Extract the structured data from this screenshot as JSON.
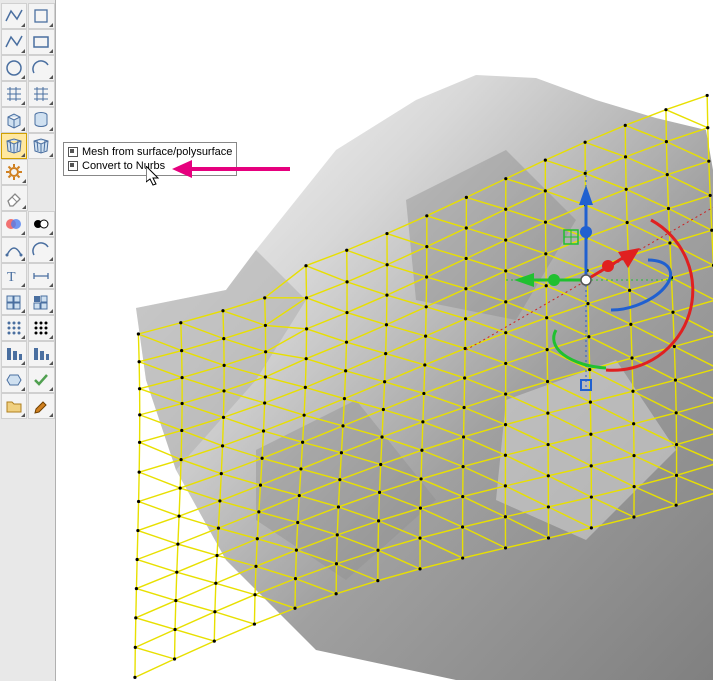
{
  "toolbar": {
    "rows": [
      {
        "a": {
          "name": "chain-edges-icon",
          "color": "#4a6fa0"
        },
        "b": {
          "name": "align-icon",
          "color": "#4a6fa0"
        }
      },
      {
        "a": {
          "name": "polyline-icon",
          "color": "#4a6fa0"
        },
        "b": {
          "name": "rectangle-icon",
          "color": "#4a6fa0"
        }
      },
      {
        "a": {
          "name": "circle-icon",
          "color": "#4a6fa0"
        },
        "b": {
          "name": "arc-icon",
          "color": "#4a6fa0"
        }
      },
      {
        "a": {
          "name": "grid-snap-icon",
          "color": "#4a6fa0"
        },
        "b": {
          "name": "plane-icon",
          "color": "#4a6fa0"
        }
      },
      {
        "a": {
          "name": "solid-box-icon",
          "color": "#4a6fa0"
        },
        "b": {
          "name": "solid-cylinder-icon",
          "color": "#4a6fa0"
        }
      },
      {
        "a": {
          "name": "mesh-icon",
          "color": "#4a6fa0",
          "active": true
        },
        "b": {
          "name": "mesh-convert-icon",
          "color": "#4a6fa0"
        }
      },
      {
        "a": {
          "name": "gears-icon",
          "color": "#d08020"
        },
        "b": null
      },
      {
        "a": {
          "name": "eraser-icon",
          "color": "#808080"
        },
        "b": null
      },
      {
        "a": {
          "name": "layers-icon",
          "color": "#4a6fa0"
        },
        "b": {
          "name": "color-swatch-icon",
          "color": "#000"
        }
      },
      {
        "a": {
          "name": "curve-from-two-views-icon",
          "color": "#4a6fa0"
        },
        "b": {
          "name": "tween-curves-icon",
          "color": "#4a6fa0"
        }
      },
      {
        "a": {
          "name": "text-icon",
          "color": "#4a6fa0"
        },
        "b": {
          "name": "dimension-icon",
          "color": "#4a6fa0"
        }
      },
      {
        "a": {
          "name": "block-manager-icon",
          "color": "#4a6fa0"
        },
        "b": {
          "name": "block-edit-icon",
          "color": "#4a6fa0"
        }
      },
      {
        "a": {
          "name": "array-icon",
          "color": "#4a6fa0"
        },
        "b": {
          "name": "matrix-icon",
          "color": "#000"
        }
      },
      {
        "a": {
          "name": "align-objects-icon",
          "color": "#4a6fa0"
        },
        "b": {
          "name": "distribute-icon",
          "color": "#4a6fa0"
        }
      },
      {
        "a": {
          "name": "boolean-union-icon",
          "color": "#4a6fa0"
        },
        "b": {
          "name": "analysis-check-icon",
          "color": "#50a050"
        }
      },
      {
        "a": {
          "name": "open-folder-icon",
          "color": "#d0a040"
        },
        "b": {
          "name": "paint-icon",
          "color": "#d08020"
        }
      }
    ]
  },
  "tooltip": {
    "line1": "Mesh from surface/polysurface",
    "line2": "Convert to Nurbs"
  },
  "viewport": {
    "gumball_visible": true
  }
}
